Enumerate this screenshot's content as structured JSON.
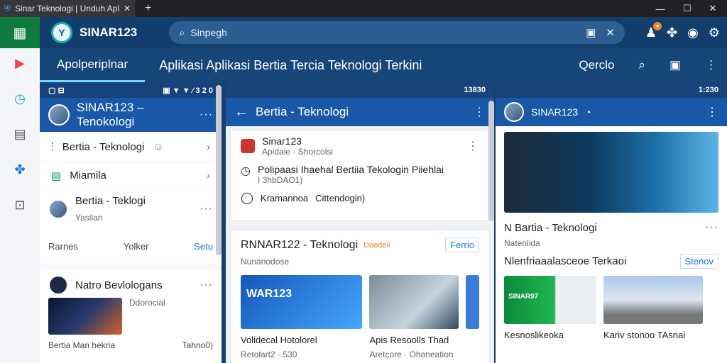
{
  "window": {
    "tab_title": "Sinar Teknologi | Unduh Aplikasi",
    "new_tab": "+",
    "minimize": "—",
    "maximize": "☐",
    "close": "✕"
  },
  "brand": {
    "name": "SINAR123",
    "logo_letter": "Y"
  },
  "search": {
    "placeholder": "Sinpegh"
  },
  "nav": {
    "active_tab": "Apolperiplnar",
    "headline": "Aplikasi Aplikasi Bertia Tercia Teknologi Terkini",
    "right_label": "Qerclo"
  },
  "panel_left": {
    "status_left": "▢ ⊟",
    "status_right": "▣ ▼ ▼ ⁄ 3 2 0",
    "title": "SINAR123 – Tenokologi",
    "items": [
      {
        "label": "Bertia - Teknologi"
      },
      {
        "label": "Miamila"
      }
    ],
    "post": {
      "title": "Bertia - Teklogi",
      "subtitle": "Yasilan",
      "action_1": "Rarnes",
      "action_2": "Yolker",
      "action_3": "Setu"
    },
    "card2": {
      "title": "Natro Bevlologans",
      "side_text": "Ddorocial",
      "footer": "Bertia Man hekria",
      "footer_right": "Tahno0)"
    }
  },
  "panel_mid": {
    "status_right": "13830",
    "title": "Bertia - Teknologi",
    "post_author": "Sinar123",
    "post_meta": "Apidale · Shorcolsi",
    "list": [
      {
        "label": "Polipaasi Ihaehal Bertiia Tekologin Piiehlai",
        "sub": "I 3hbDAO1)"
      },
      {
        "label": "Kramannoa",
        "sub": "Cittendogin)"
      }
    ],
    "card_title": "RNNAR122 - Teknologi",
    "card_badge": "Doodeii",
    "card_sub": "Nunanodose",
    "card_btn": "Ferrio",
    "thumbs": [
      {
        "banner": "WAR123",
        "caption": "Volidecal Hotolorel",
        "sub": "Retolart2 · 530"
      },
      {
        "banner": "",
        "caption": "Apis Resoolls Thad",
        "sub": "Aretcore · Ohaneation"
      }
    ]
  },
  "panel_right": {
    "status_right": "1:230",
    "title": "SINAR123",
    "hero_title": "N Bartia - Teknologi",
    "hero_sub": "Natenlida",
    "section_title": "Nlenfriaaalasceoe Terkaoi",
    "section_btn": "Stenov",
    "thumbs": [
      {
        "banner": "SINAR97",
        "caption": "Kesnoslikeoka"
      },
      {
        "banner": "",
        "caption": "Kariv stonoo TAsnai"
      }
    ]
  },
  "colors": {
    "header": "#123e6e",
    "accent_green": "#0f7b3e",
    "panel_header": "#1858a6"
  }
}
